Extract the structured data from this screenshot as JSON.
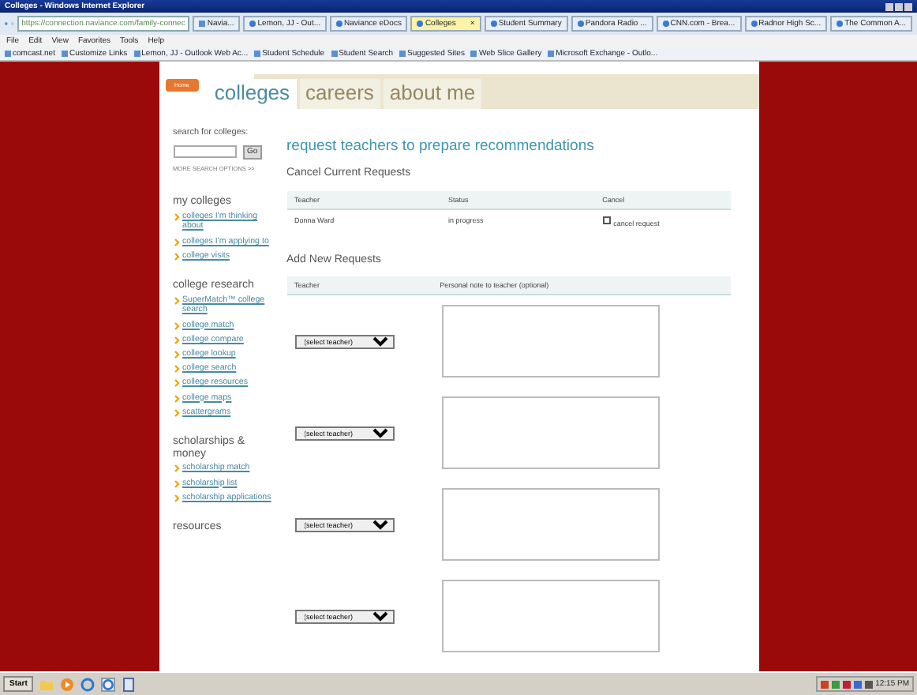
{
  "window": {
    "title": "Colleges - Windows Internet Explorer"
  },
  "address_bar": {
    "url": "https://connection.naviance.com/family-connec",
    "pinned_tab": "Navia..."
  },
  "browser_tabs": [
    {
      "label": "Lemon, JJ - Out...",
      "selected": false
    },
    {
      "label": "Naviance eDocs",
      "selected": false
    },
    {
      "label": "Colleges",
      "selected": true,
      "close": "×"
    },
    {
      "label": "Student Summary",
      "selected": false
    },
    {
      "label": "Pandora Radio ...",
      "selected": false
    },
    {
      "label": "CNN.com - Brea...",
      "selected": false
    },
    {
      "label": "Radnor High Sc...",
      "selected": false
    },
    {
      "label": "The Common A...",
      "selected": false
    }
  ],
  "menu_bar": [
    "File",
    "Edit",
    "View",
    "Favorites",
    "Tools",
    "Help"
  ],
  "favorites_bar": [
    "comcast.net",
    "Customize Links",
    "Lemon, JJ - Outlook Web Ac...",
    "Student Schedule",
    "Student Search",
    "Suggested Sites",
    "Web Slice Gallery",
    "Microsoft Exchange - Outlo..."
  ],
  "site_nav": {
    "home": "Home",
    "tabs": [
      {
        "label": "colleges",
        "selected": true
      },
      {
        "label": "careers",
        "selected": false
      },
      {
        "label": "about me",
        "selected": false
      }
    ]
  },
  "sidebar": {
    "search_label": "search for colleges:",
    "go_button": "Go",
    "more_search": "MORE SEARCH OPTIONS >>",
    "sections": [
      {
        "title": "my colleges",
        "links": [
          "colleges I'm thinking about",
          "colleges I'm applying to",
          "college visits"
        ]
      },
      {
        "title": "college research",
        "links": [
          "SuperMatch™ college search",
          "college match",
          "college compare",
          "college lookup",
          "college search",
          "college resources",
          "college maps",
          "scattergrams"
        ]
      },
      {
        "title": "scholarships & money",
        "links": [
          "scholarship match",
          "scholarship list",
          "scholarship applications"
        ]
      },
      {
        "title": "resources"
      }
    ]
  },
  "main": {
    "title": "request teachers to prepare recommendations",
    "cancel_section": {
      "heading": "Cancel Current Requests",
      "columns": [
        "Teacher",
        "Status",
        "Cancel"
      ],
      "rows": [
        {
          "teacher": "Donna Ward",
          "status": "in progress",
          "cancel_label": "cancel request",
          "checked": false
        }
      ]
    },
    "add_section": {
      "heading": "Add New Requests",
      "columns": [
        "Teacher",
        "Personal note to teacher (optional)"
      ],
      "rows": [
        {
          "select": "(select teacher)"
        },
        {
          "select": "(select teacher)"
        },
        {
          "select": "(select teacher)"
        },
        {
          "select": "(select teacher)"
        }
      ]
    }
  },
  "taskbar": {
    "start": "Start",
    "time": "12:15 PM"
  }
}
